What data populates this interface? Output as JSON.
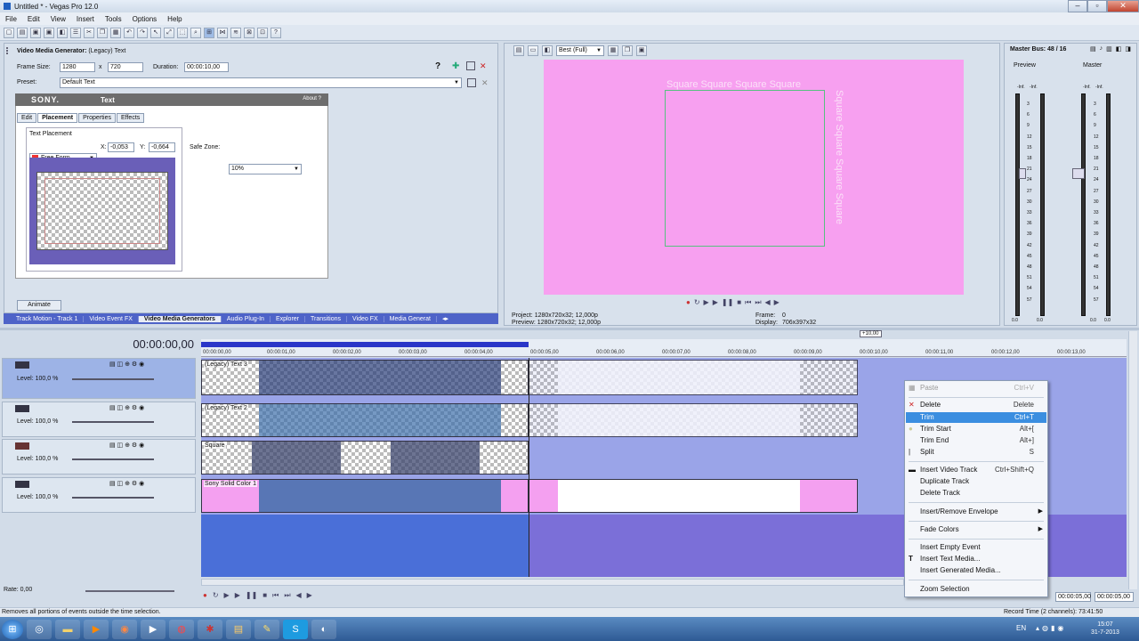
{
  "window": {
    "title": "Untitled * - Vegas Pro 12.0"
  },
  "menu": [
    "File",
    "Edit",
    "View",
    "Insert",
    "Tools",
    "Options",
    "Help"
  ],
  "generator": {
    "header": "Video Media Generator:",
    "name": "(Legacy) Text",
    "frame_size_label": "Frame Size:",
    "frame_w": "1280",
    "frame_x": "x",
    "frame_h": "720",
    "duration_label": "Duration:",
    "duration": "00:00:10,00",
    "preset_label": "Preset:",
    "preset": "Default Text",
    "brand": "SONY.",
    "plugin": "Text",
    "about": "About",
    "about_q": "?",
    "tabs": [
      "Edit",
      "Placement",
      "Properties",
      "Effects"
    ],
    "text_placement_label": "Text Placement",
    "placement_mode": "Free Form",
    "x_label": "X:",
    "x_value": "-0,053",
    "y_label": "Y:",
    "y_value": "-0,664",
    "safe_zone_label": "Safe Zone:",
    "safe_zone": "10%",
    "animate": "Animate"
  },
  "docktabs": [
    "Track Motion - Track 1",
    "Video Event FX",
    "Video Media Generators",
    "Audio Plug-In",
    "Explorer",
    "Transitions",
    "Video FX",
    "Media Generat"
  ],
  "preview": {
    "quality": "Best (Full)",
    "text_horizontal": "Square Square Square Square",
    "text_vertical": "Square Square Square Square",
    "project_label": "Project:",
    "project": "1280x720x32; 12,000p",
    "preview_label": "Preview:",
    "preview": "1280x720x32; 12,000p",
    "frame_label": "Frame:",
    "frame": "0",
    "display_label": "Display:",
    "display": "706x397x32"
  },
  "master": {
    "title": "Master Bus: 48 / 16",
    "preview_label": "Preview",
    "master_label": "Master",
    "inf1": "-Inf.",
    "inf2": "-Inf.",
    "inf3": "-Inf.",
    "inf4": "-Inf.",
    "scale": [
      "3",
      "6",
      "9",
      "12",
      "15",
      "18",
      "21",
      "24",
      "27",
      "30",
      "33",
      "36",
      "39",
      "42",
      "45",
      "48",
      "51",
      "54",
      "57"
    ],
    "val1": "0.0",
    "val2": "0.0",
    "val3": "0.0",
    "val4": "0.0"
  },
  "timeline": {
    "timecode": "00:00:00,00",
    "marker": "+10,00",
    "ruler": [
      "00:00:00,00",
      "00:00:01,00",
      "00:00:02,00",
      "00:00:03,00",
      "00:00:04,00",
      "00:00:05,00",
      "00:00:06,00",
      "00:00:07,00",
      "00:00:08,00",
      "00:00:09,00",
      "00:00:10,00",
      "00:00:11,00",
      "00:00:12,00",
      "00:00:13,00"
    ],
    "tracks": [
      {
        "level": "Level: 100,0 %",
        "event": "(Legacy) Text 3"
      },
      {
        "level": "Level: 100,0 %",
        "event": "(Legacy) Text 2"
      },
      {
        "level": "Level: 100,0 %",
        "event": "Square"
      },
      {
        "level": "Level: 100,0 %",
        "event": "Sony Solid Color 1"
      }
    ],
    "rate": "Rate: 0,00",
    "end_time1": "00:00:05,00",
    "end_time2": "00:00:05,00"
  },
  "context_menu": [
    {
      "label": "Paste",
      "shortcut": "Ctrl+V",
      "disabled": true
    },
    {
      "label": "Delete",
      "shortcut": "Delete"
    },
    {
      "label": "Trim",
      "shortcut": "Ctrl+T",
      "highlight": true
    },
    {
      "label": "Trim Start",
      "shortcut": "Alt+["
    },
    {
      "label": "Trim End",
      "shortcut": "Alt+]"
    },
    {
      "label": "Split",
      "shortcut": "S"
    },
    {
      "label": "Insert Video Track",
      "shortcut": "Ctrl+Shift+Q"
    },
    {
      "label": "Duplicate Track",
      "shortcut": ""
    },
    {
      "label": "Delete Track",
      "shortcut": ""
    },
    {
      "label": "Insert/Remove Envelope",
      "shortcut": ""
    },
    {
      "label": "Fade Colors",
      "shortcut": ""
    },
    {
      "label": "Insert Empty Event",
      "shortcut": ""
    },
    {
      "label": "Insert Text Media...",
      "shortcut": ""
    },
    {
      "label": "Insert Generated Media...",
      "shortcut": ""
    },
    {
      "label": "Zoom Selection",
      "shortcut": ""
    }
  ],
  "status": {
    "left": "Removes all portions of events outside the time selection.",
    "record": "Record Time (2 channels): 73:41:50"
  },
  "taskbar": {
    "lang": "EN",
    "time": "15:07",
    "date": "31-7-2013"
  },
  "colors": {
    "accent": "#3b8ee0",
    "preview_bg": "#f7a0f0",
    "track_blue": "#4a6fd8",
    "track_purple": "#7b6fd8"
  }
}
